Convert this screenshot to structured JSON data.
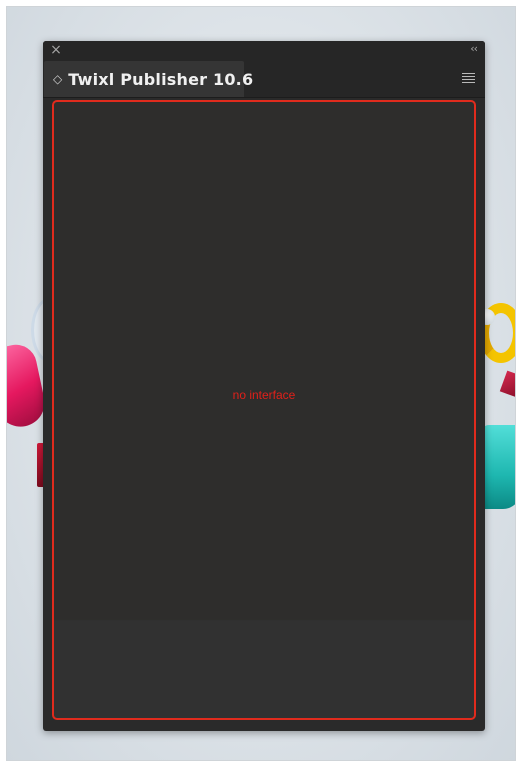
{
  "panel": {
    "close_icon": "close-icon",
    "collapse_icon": "double-chevron-left-icon",
    "collapse_glyph": "‹‹",
    "tab": {
      "title": "Twixl Publisher 10.6",
      "chevron_icon": "up-down-chevron-icon"
    },
    "menu_icon": "hamburger-menu-icon"
  },
  "content": {
    "message": "no interface",
    "border_color": "#e02b1d",
    "message_color": "#e0201a"
  }
}
